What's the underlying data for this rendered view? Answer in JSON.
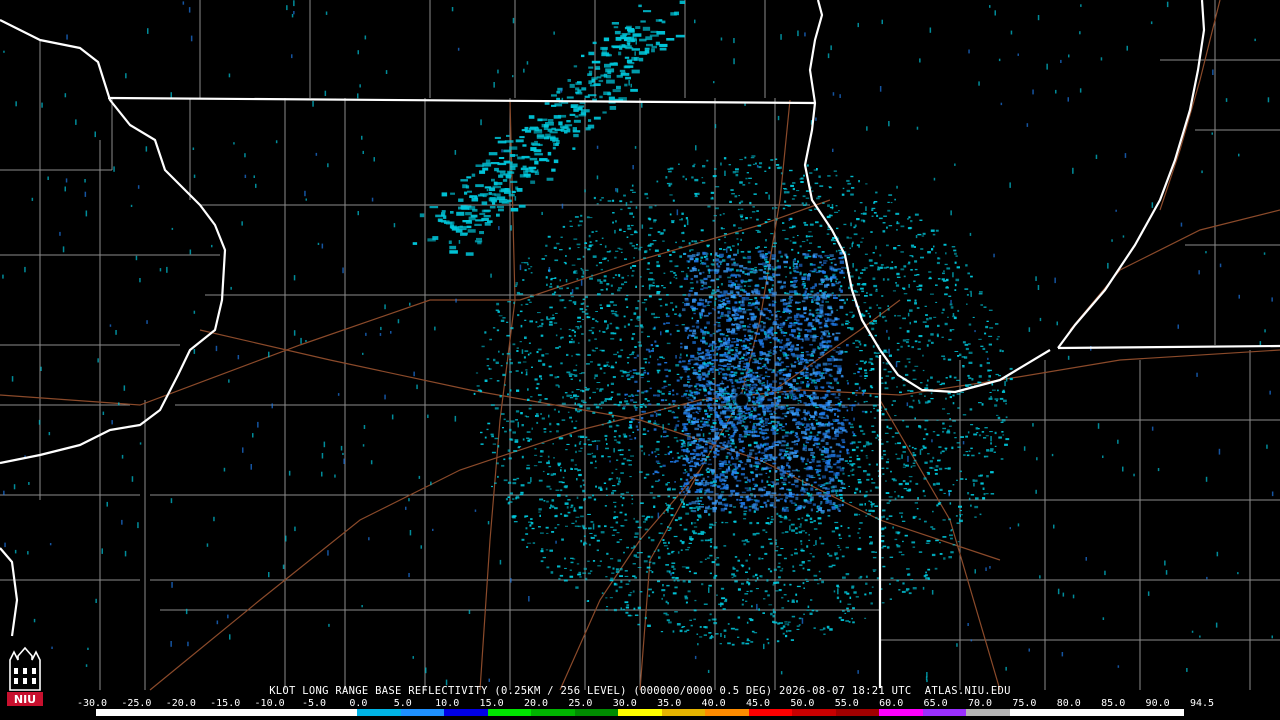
{
  "caption": "KLOT LONG RANGE BASE REFLECTIVITY (0.25KM / 256 LEVEL) (000000/0000 0.5 DEG) 2026-08-07 18:21 UTC  ATLAS.NIU.EDU",
  "scale_labels": [
    "-30.0",
    "-25.0",
    "-20.0",
    "-15.0",
    "-10.0",
    "-5.0",
    "0.0",
    "5.0",
    "10.0",
    "15.0",
    "20.0",
    "25.0",
    "30.0",
    "35.0",
    "40.0",
    "45.0",
    "50.0",
    "55.0",
    "60.0",
    "65.0",
    "70.0",
    "75.0",
    "80.0",
    "85.0",
    "90.0",
    "94.5"
  ],
  "scale_colors": [
    "#ffffff",
    "#ffffff",
    "#ffffff",
    "#ffffff",
    "#ffffff",
    "#ffffff",
    "#00b4e6",
    "#1e90ff",
    "#0000e6",
    "#00e600",
    "#00b400",
    "#008c00",
    "#ffff00",
    "#e6b400",
    "#ff8c00",
    "#ff0000",
    "#c80000",
    "#a00000",
    "#ff00ff",
    "#9b30ff",
    "#b4b4b4",
    "#ffffff",
    "#ffffff",
    "#ffffff",
    "#ffffff"
  ],
  "logo_text": "NIU",
  "colors": {
    "background": "#000000",
    "state_border": "#ffffff",
    "county_line": "#8c8c8c",
    "highway": "#8b4a2a",
    "echo_light": "#00c8dc",
    "echo_medium": "#1e78e6",
    "radar_site": "#000000"
  }
}
